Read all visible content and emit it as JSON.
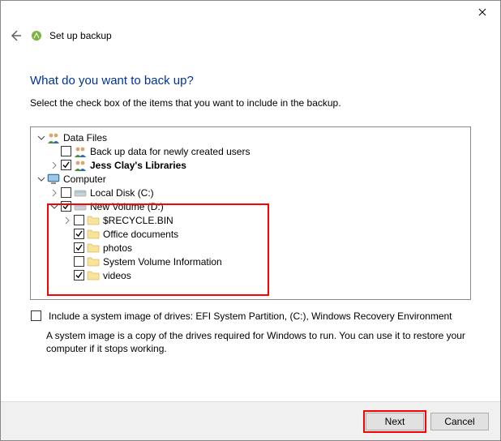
{
  "window": {
    "heading": "What do you want to back up?",
    "subtext": "Select the check box of the items that you want to include in the backup.",
    "header_title": "Set up backup"
  },
  "tree": {
    "data_files": {
      "expanded": true,
      "label": "Data Files"
    },
    "new_users": {
      "checked": false,
      "label": "Back up data for newly created users"
    },
    "libraries": {
      "checked": true,
      "label": "Jess Clay's Libraries"
    },
    "computer": {
      "expanded": true,
      "label": "Computer"
    },
    "local_c": {
      "checked": false,
      "label": "Local Disk (C:)"
    },
    "new_d": {
      "checked": true,
      "expanded": true,
      "label": "New Volume (D:)"
    },
    "recycle": {
      "checked": false,
      "label": "$RECYCLE.BIN"
    },
    "office": {
      "checked": true,
      "label": "Office documents"
    },
    "photos": {
      "checked": true,
      "label": "photos"
    },
    "svi": {
      "checked": false,
      "label": "System Volume Information"
    },
    "videos": {
      "checked": true,
      "label": "videos"
    }
  },
  "sysimage": {
    "checked": false,
    "label": "Include a system image of drives: EFI System Partition, (C:), Windows Recovery Environment",
    "desc": "A system image is a copy of the drives required for Windows to run. You can use it to restore your computer if it stops working."
  },
  "buttons": {
    "next": "Next",
    "cancel": "Cancel"
  }
}
